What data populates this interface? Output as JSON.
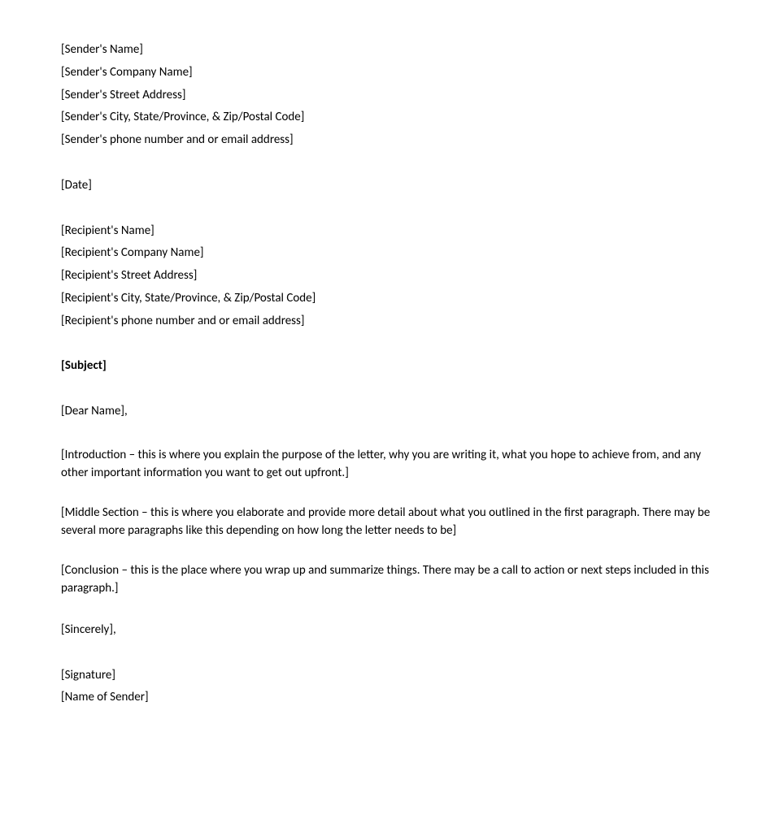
{
  "sender": {
    "name": "[Sender's Name]",
    "company": "[Sender's Company Name]",
    "street": "[Sender's Street Address]",
    "cityStateZip": "[Sender's City, State/Province, & Zip/Postal Code]",
    "contact": "[Sender's phone number and or email address]"
  },
  "date": "[Date]",
  "recipient": {
    "name": "[Recipient's Name]",
    "company": "[Recipient's Company Name]",
    "street": "[Recipient's Street Address]",
    "cityStateZip": "[Recipient's City, State/Province, & Zip/Postal Code]",
    "contact": "[Recipient's phone number and or email address]"
  },
  "subject": "[Subject]",
  "salutation": "[Dear Name],",
  "body": {
    "introduction": "[Introduction – this is where you explain the purpose of the letter, why you are writing it, what you hope to achieve from, and any other important information you want to get out upfront.]",
    "middle": "[Middle Section – this is where you elaborate and provide more detail about what you outlined in the first paragraph. There may be several more paragraphs like this depending on how long the letter needs to be]",
    "conclusion": "[Conclusion – this is the place where you wrap up and summarize things. There may be a call to action or next steps included in this paragraph.]"
  },
  "closing": "[Sincerely],",
  "signature": {
    "sign": "[Signature]",
    "name": "[Name of Sender]"
  }
}
